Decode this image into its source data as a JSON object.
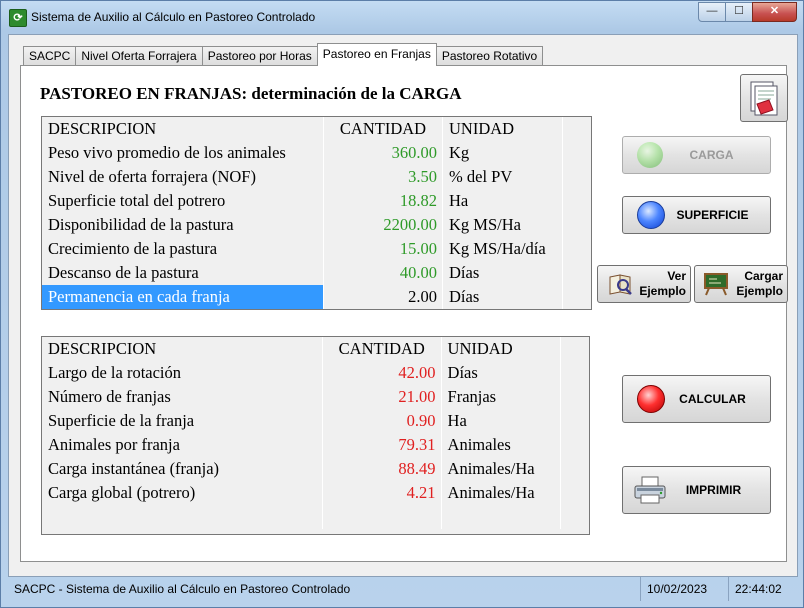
{
  "window": {
    "title": "Sistema de Auxilio al Cálculo en Pastoreo Controlado",
    "min": "—",
    "max": "☐",
    "close": "✕",
    "app_icon": "⟳"
  },
  "tabs": [
    {
      "label": "SACPC"
    },
    {
      "label": "Nivel Oferta Forrajera"
    },
    {
      "label": "Pastoreo por Horas"
    },
    {
      "label": "Pastoreo en Franjas",
      "active": true
    },
    {
      "label": "Pastoreo Rotativo"
    }
  ],
  "heading": "PASTOREO EN FRANJAS: determinación de la CARGA",
  "input_table": {
    "headers": [
      "DESCRIPCION",
      "CANTIDAD",
      "UNIDAD"
    ],
    "rows": [
      {
        "desc": "Peso vivo promedio de los animales",
        "qty": "360.00",
        "unit": "Kg"
      },
      {
        "desc": "Nivel de oferta forrajera (NOF)",
        "qty": "3.50",
        "unit": "% del PV"
      },
      {
        "desc": "Superficie total del potrero",
        "qty": "18.82",
        "unit": "Ha"
      },
      {
        "desc": "Disponibilidad de la pastura",
        "qty": "2200.00",
        "unit": "Kg MS/Ha"
      },
      {
        "desc": "Crecimiento de la pastura",
        "qty": "15.00",
        "unit": "Kg MS/Ha/día"
      },
      {
        "desc": "Descanso de la pastura",
        "qty": "40.00",
        "unit": "Días"
      },
      {
        "desc": "Permanencia en cada franja",
        "qty": "2.00",
        "unit": "Días"
      }
    ]
  },
  "output_table": {
    "headers": [
      "DESCRIPCION",
      "CANTIDAD",
      "UNIDAD"
    ],
    "rows": [
      {
        "desc": "Largo de la rotación",
        "qty": "42.00",
        "unit": "Días"
      },
      {
        "desc": "Número de franjas",
        "qty": "21.00",
        "unit": "Franjas"
      },
      {
        "desc": "Superficie de la franja",
        "qty": "0.90",
        "unit": "Ha"
      },
      {
        "desc": "Animales por franja",
        "qty": "79.31",
        "unit": "Animales"
      },
      {
        "desc": "Carga instantánea (franja)",
        "qty": "88.49",
        "unit": "Animales/Ha"
      },
      {
        "desc": "Carga global (potrero)",
        "qty": "4.21",
        "unit": "Animales/Ha"
      }
    ]
  },
  "buttons": {
    "carga": "CARGA",
    "superficie": "SUPERFICIE",
    "ver_ejemplo_1": "Ver",
    "ver_ejemplo_2": "Ejemplo",
    "cargar_ejemplo_1": "Cargar",
    "cargar_ejemplo_2": "Ejemplo",
    "calcular": "CALCULAR",
    "imprimir": "IMPRIMIR"
  },
  "status": {
    "text": "SACPC - Sistema de Auxilio al Cálculo en Pastoreo Controlado",
    "date": "10/02/2023",
    "time": "22:44:02"
  },
  "colors": {
    "input_values": "#2e9a28",
    "output_values": "#e02020",
    "selection": "#3399ff"
  }
}
